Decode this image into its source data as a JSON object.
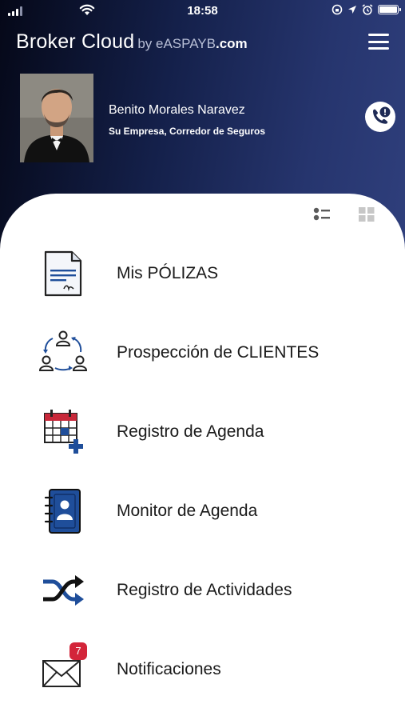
{
  "status_bar": {
    "time": "18:58",
    "icons": [
      "signal-icon",
      "wifi-icon",
      "screen-rotation-lock-icon",
      "location-icon",
      "alarm-icon",
      "battery-icon"
    ]
  },
  "header": {
    "brand_name": "Broker Cloud",
    "brand_by": "by eASPAYB",
    "brand_domain": ".com",
    "menu_icon": "hamburger-icon"
  },
  "profile": {
    "name": "Benito Morales Naravez",
    "company": "Su Empresa, Corredor de Seguros",
    "call_icon": "phone-alert-icon"
  },
  "view_toggle": {
    "list_icon": "list-view-icon",
    "grid_icon": "grid-view-icon"
  },
  "menu": {
    "items": [
      {
        "label": "Mis PÓLIZAS",
        "icon": "policy-document-icon"
      },
      {
        "label": "Prospección de CLIENTES",
        "icon": "client-cycle-icon"
      },
      {
        "label": "Registro de Agenda",
        "icon": "calendar-add-icon"
      },
      {
        "label": "Monitor de Agenda",
        "icon": "contact-book-icon"
      },
      {
        "label": "Registro de Actividades",
        "icon": "shuffle-icon"
      },
      {
        "label": "Notificaciones",
        "icon": "envelope-icon",
        "badge": "7"
      }
    ]
  },
  "colors": {
    "header_dark": "#050818",
    "header_light": "#2f3f7c",
    "accent_blue": "#1f4e9a",
    "badge_red": "#d3253a"
  }
}
